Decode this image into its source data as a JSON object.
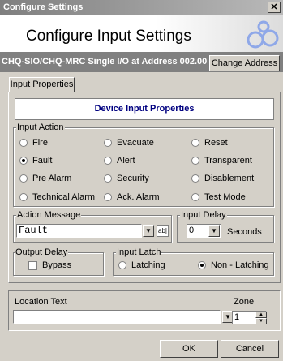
{
  "window": {
    "title": "Configure Settings",
    "close_glyph": "✕"
  },
  "header": {
    "title": "Configure Input Settings"
  },
  "device_bar": {
    "text": "CHQ-SIO/CHQ-MRC Single I/O at Address 002.00",
    "change_address_label": "Change Address"
  },
  "tabs": [
    {
      "label": "Input Properties"
    }
  ],
  "panel_title": "Device Input Properties",
  "input_action": {
    "legend": "Input Action",
    "options": [
      {
        "label": "Fire",
        "selected": false
      },
      {
        "label": "Evacuate",
        "selected": false
      },
      {
        "label": "Reset",
        "selected": false
      },
      {
        "label": "Fault",
        "selected": true
      },
      {
        "label": "Alert",
        "selected": false
      },
      {
        "label": "Transparent",
        "selected": false
      },
      {
        "label": "Pre Alarm",
        "selected": false
      },
      {
        "label": "Security",
        "selected": false
      },
      {
        "label": "Disablement",
        "selected": false
      },
      {
        "label": "Technical Alarm",
        "selected": false
      },
      {
        "label": "Ack. Alarm",
        "selected": false
      },
      {
        "label": "Test Mode",
        "selected": false
      }
    ]
  },
  "action_message": {
    "legend": "Action Message",
    "value": "Fault",
    "edit_glyph": "ab|"
  },
  "input_delay": {
    "legend": "Input Delay",
    "value": "0",
    "units": "Seconds"
  },
  "output_delay": {
    "legend": "Output Delay",
    "bypass_label": "Bypass",
    "bypass_checked": false
  },
  "input_latch": {
    "legend": "Input Latch",
    "options": [
      {
        "label": "Latching",
        "selected": false
      },
      {
        "label": "Non - Latching",
        "selected": true
      }
    ]
  },
  "location": {
    "label": "Location Text",
    "value": ""
  },
  "zone": {
    "label": "Zone",
    "value": "1"
  },
  "buttons": {
    "ok": "OK",
    "cancel": "Cancel"
  },
  "glyphs": {
    "dropdown": "▼",
    "spin_up": "▲",
    "spin_down": "▼"
  },
  "colors": {
    "title_bar": "#808080",
    "panel_title": "#000080",
    "dialog_bg": "#d4d0c8",
    "logo": "#8fa8e8"
  }
}
